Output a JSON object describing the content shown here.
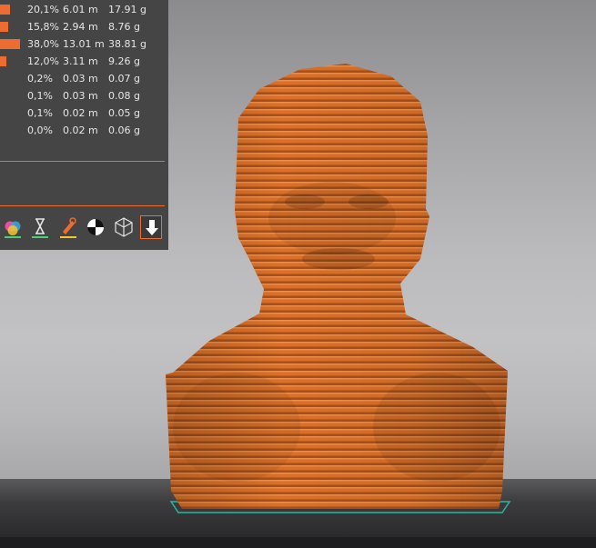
{
  "stats_table": {
    "rows": [
      {
        "percent": "20,1%",
        "length": "6.01 m",
        "weight": "17.91 g",
        "share": 0.201
      },
      {
        "percent": "15,8%",
        "length": "2.94 m",
        "weight": "8.76 g",
        "share": 0.158
      },
      {
        "percent": "38,0%",
        "length": "13.01 m",
        "weight": "38.81 g",
        "share": 0.38
      },
      {
        "percent": "12,0%",
        "length": "3.11 m",
        "weight": "9.26 g",
        "share": 0.12
      },
      {
        "percent": "0,2%",
        "length": "0.03 m",
        "weight": "0.07 g",
        "share": 0.002
      },
      {
        "percent": "0,1%",
        "length": "0.03 m",
        "weight": "0.08 g",
        "share": 0.001
      },
      {
        "percent": "0,1%",
        "length": "0.02 m",
        "weight": "0.05 g",
        "share": 0.001
      },
      {
        "percent": "0,0%",
        "length": "0.02 m",
        "weight": "0.06 g",
        "share": 0.0
      }
    ]
  },
  "toolbar": {
    "icons": [
      "color-palette-icon",
      "hourglass-icon",
      "slicer-pen-icon",
      "center-target-icon",
      "wireframe-cube-icon",
      "export-download-icon"
    ]
  },
  "colors": {
    "accent": "#ed6c32",
    "panel": "#454545",
    "model": "#d8702c",
    "model_shadow": "#a64f1a",
    "plate_outline": "#2bb5a0"
  }
}
